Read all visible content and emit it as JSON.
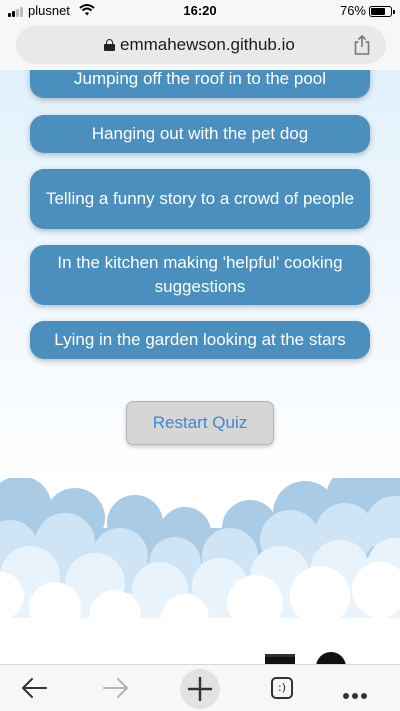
{
  "status_bar": {
    "carrier": "plusnet",
    "time": "16:20",
    "battery_percent": "76%",
    "battery_level": 0.76
  },
  "browser": {
    "url": "emmahewson.github.io"
  },
  "quiz": {
    "answers": [
      "Jumping off the roof in to the pool",
      "Hanging out with the pet dog",
      "Telling a funny story to a crowd of people",
      "In the kitchen making 'helpful' cooking suggestions",
      "Lying in the garden looking at the stars"
    ],
    "restart_label": "Restart Quiz"
  },
  "toolbar": {
    "tabs_label": ":)"
  },
  "colors": {
    "answer_bg": "#4a8fbd",
    "restart_text": "#3f86d6",
    "sky_top": "#d6ecfa"
  }
}
